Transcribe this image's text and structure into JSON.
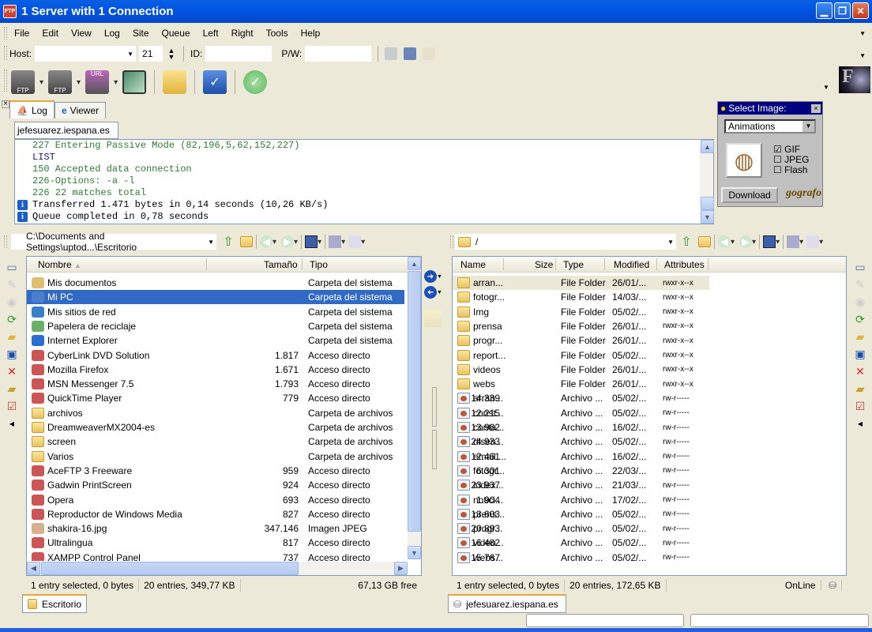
{
  "window": {
    "title": "1 Server with 1 Connection",
    "app_icon": "ftp-app-icon"
  },
  "menu": [
    "File",
    "Edit",
    "View",
    "Log",
    "Site",
    "Queue",
    "Left",
    "Right",
    "Tools",
    "Help"
  ],
  "connect_bar": {
    "host_label": "Host:",
    "host_value": "",
    "port_value": "21",
    "id_label": "ID:",
    "id_value": "",
    "pw_label": "P/W:",
    "pw_value": ""
  },
  "toolbar": {
    "buttons": [
      "connect-ftp",
      "quick-connect-ftp",
      "url-connect",
      "sync-browse",
      "open-folder",
      "edit-site",
      "done"
    ]
  },
  "log": {
    "tabs": [
      {
        "label": "Log",
        "active": true
      },
      {
        "label": "Viewer",
        "active": false
      }
    ],
    "site_tab": "jefesuarez.iespana.es",
    "lines": [
      {
        "text": "227 Entering Passive Mode (82,196,5,62,152,227)",
        "color": "#2e7d32",
        "info": false
      },
      {
        "text": "LIST",
        "color": "#1a1a8c",
        "info": false
      },
      {
        "text": "150 Accepted data connection",
        "color": "#2e7d32",
        "info": false
      },
      {
        "text": "226-Options: -a -l",
        "color": "#2e7d32",
        "info": false
      },
      {
        "text": "226 22 matches total",
        "color": "#2e7d32",
        "info": false
      },
      {
        "text": "Transferred 1.471 bytes in 0,14 seconds (10,26 KB/s)",
        "color": "#000000",
        "info": true
      },
      {
        "text": "Queue completed in 0,78 seconds",
        "color": "#000000",
        "info": true
      }
    ]
  },
  "ad_widget": {
    "title": "Select Image:",
    "dropdown": "Animations",
    "options": [
      {
        "label": "GIF",
        "checked": true
      },
      {
        "label": "JPEG",
        "checked": false
      },
      {
        "label": "Flash",
        "checked": false
      }
    ],
    "download": "Download",
    "brand": "gografo"
  },
  "left": {
    "path": "C:\\Documents and Settings\\uptod...\\Escritorio",
    "columns": [
      "Nombre",
      "Tamaño",
      "Tipo"
    ],
    "rows": [
      {
        "name": "Mis documentos",
        "size": "",
        "type": "Carpeta del sistema",
        "icon": "my-documents-icon"
      },
      {
        "name": "Mi PC",
        "size": "",
        "type": "Carpeta del sistema",
        "icon": "my-computer-icon",
        "selected": true
      },
      {
        "name": "Mis sitios de red",
        "size": "",
        "type": "Carpeta del sistema",
        "icon": "network-icon"
      },
      {
        "name": "Papelera de reciclaje",
        "size": "",
        "type": "Carpeta del sistema",
        "icon": "recycle-bin-icon"
      },
      {
        "name": "Internet Explorer",
        "size": "",
        "type": "Carpeta del sistema",
        "icon": "ie-icon"
      },
      {
        "name": "CyberLink DVD Solution",
        "size": "1.817",
        "type": "Acceso directo",
        "icon": "shortcut-icon"
      },
      {
        "name": "Mozilla Firefox",
        "size": "1.671",
        "type": "Acceso directo",
        "icon": "shortcut-icon"
      },
      {
        "name": "MSN Messenger 7.5",
        "size": "1.793",
        "type": "Acceso directo",
        "icon": "shortcut-icon"
      },
      {
        "name": "QuickTime Player",
        "size": "779",
        "type": "Acceso directo",
        "icon": "shortcut-icon"
      },
      {
        "name": "archivos",
        "size": "",
        "type": "Carpeta de archivos",
        "icon": "folder-icon"
      },
      {
        "name": "DreamweaverMX2004-es",
        "size": "",
        "type": "Carpeta de archivos",
        "icon": "folder-icon"
      },
      {
        "name": "screen",
        "size": "",
        "type": "Carpeta de archivos",
        "icon": "folder-icon"
      },
      {
        "name": "Varios",
        "size": "",
        "type": "Carpeta de archivos",
        "icon": "folder-icon"
      },
      {
        "name": "AceFTP 3 Freeware",
        "size": "959",
        "type": "Acceso directo",
        "icon": "shortcut-icon"
      },
      {
        "name": "Gadwin PrintScreen",
        "size": "924",
        "type": "Acceso directo",
        "icon": "shortcut-icon"
      },
      {
        "name": "Opera",
        "size": "693",
        "type": "Acceso directo",
        "icon": "shortcut-icon"
      },
      {
        "name": "Reproductor de Windows Media",
        "size": "827",
        "type": "Acceso directo",
        "icon": "shortcut-icon"
      },
      {
        "name": "shakira-16.jpg",
        "size": "347.146",
        "type": "Imagen JPEG",
        "icon": "image-file-icon"
      },
      {
        "name": "Ultralingua",
        "size": "817",
        "type": "Acceso directo",
        "icon": "shortcut-icon"
      },
      {
        "name": "XAMPP Control Panel",
        "size": "737",
        "type": "Acceso directo",
        "icon": "shortcut-icon"
      }
    ],
    "status": {
      "selected": "1 entry selected, 0 bytes",
      "entries": "20 entries, 349,77 KB",
      "free": "67,13 GB free"
    },
    "tab": "Escritorio"
  },
  "right": {
    "path": "/",
    "columns": [
      "Name",
      "Size",
      "Type",
      "Modified",
      "Attributes"
    ],
    "rows": [
      {
        "name": "arran...",
        "size": "",
        "type": "File Folder",
        "modified": "26/01/...",
        "attr": "rwxr-x--x",
        "folder": true,
        "selected": true
      },
      {
        "name": "fotogr...",
        "size": "",
        "type": "File Folder",
        "modified": "14/03/...",
        "attr": "rwxr-x--x",
        "folder": true
      },
      {
        "name": "Img",
        "size": "",
        "type": "File Folder",
        "modified": "05/02/...",
        "attr": "rwxr-x--x",
        "folder": true
      },
      {
        "name": "prensa",
        "size": "",
        "type": "File Folder",
        "modified": "26/01/...",
        "attr": "rwxr-x--x",
        "folder": true
      },
      {
        "name": "progr...",
        "size": "",
        "type": "File Folder",
        "modified": "26/01/...",
        "attr": "rwxr-x--x",
        "folder": true
      },
      {
        "name": "report...",
        "size": "",
        "type": "File Folder",
        "modified": "05/02/...",
        "attr": "rwxr-x--x",
        "folder": true
      },
      {
        "name": "videos",
        "size": "",
        "type": "File Folder",
        "modified": "26/01/...",
        "attr": "rwxr-x--x",
        "folder": true
      },
      {
        "name": "webs",
        "size": "",
        "type": "File Folder",
        "modified": "26/01/...",
        "attr": "rwxr-x--x",
        "folder": true
      },
      {
        "name": "arran...",
        "size": "14.339",
        "type": "Archivo ...",
        "modified": "05/02/...",
        "attr": "rw-r-----"
      },
      {
        "name": "const...",
        "size": "12.215",
        "type": "Archivo ...",
        "modified": "05/02/...",
        "attr": "rw-r-----"
      },
      {
        "name": "conta...",
        "size": "13.962",
        "type": "Archivo ...",
        "modified": "16/02/...",
        "attr": "rw-r-----"
      },
      {
        "name": "disen...",
        "size": "24.933",
        "type": "Archivo ...",
        "modified": "05/02/...",
        "attr": "rw-r-----"
      },
      {
        "name": "email....",
        "size": "12.461",
        "type": "Archivo ...",
        "modified": "16/02/...",
        "attr": "rw-r-----"
      },
      {
        "name": "fotogr...",
        "size": "6.301",
        "type": "Archivo ...",
        "modified": "22/03/...",
        "attr": "rw-r-----"
      },
      {
        "name": "index...",
        "size": "23.937",
        "type": "Archivo ...",
        "modified": "21/03/...",
        "attr": "rw-r-----"
      },
      {
        "name": "notici...",
        "size": "1.904",
        "type": "Archivo ...",
        "modified": "17/02/...",
        "attr": "rw-r-----"
      },
      {
        "name": "prens...",
        "size": "13.603",
        "type": "Archivo ...",
        "modified": "05/02/...",
        "attr": "rw-r-----"
      },
      {
        "name": "progr...",
        "size": "20.893",
        "type": "Archivo ...",
        "modified": "05/02/...",
        "attr": "rw-r-----"
      },
      {
        "name": "video...",
        "size": "16.482",
        "type": "Archivo ...",
        "modified": "05/02/...",
        "attr": "rw-r-----"
      },
      {
        "name": "webs...",
        "size": "15.767",
        "type": "Archivo ...",
        "modified": "05/02/...",
        "attr": "rw-r-----"
      }
    ],
    "status": {
      "selected": "1 entry selected, 0 bytes",
      "entries": "20 entries, 172,65 KB",
      "online": "OnLine"
    },
    "tab": "jefesuarez.iespana.es"
  }
}
